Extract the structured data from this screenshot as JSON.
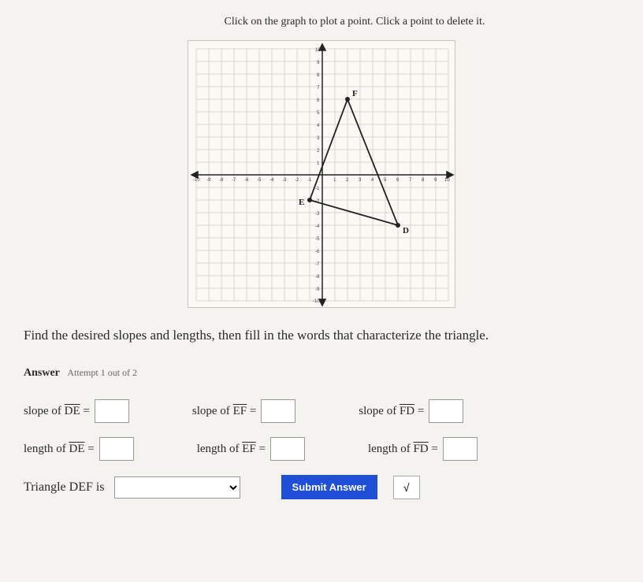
{
  "instruction": "Click on the graph to plot a point. Click a point to delete it.",
  "question": "Find the desired slopes and lengths, then fill in the words that characterize the triangle.",
  "answer": {
    "label": "Answer",
    "attempt": "Attempt 1 out of 2"
  },
  "fields": {
    "slopeDE": {
      "label_prefix": "slope of ",
      "seg": "DE",
      "equals": " ="
    },
    "slopeEF": {
      "label_prefix": "slope of ",
      "seg": "EF",
      "equals": " ="
    },
    "slopeFD": {
      "label_prefix": "slope of ",
      "seg": "FD",
      "equals": " ="
    },
    "lengthDE": {
      "label_prefix": "length of ",
      "seg": "DE",
      "equals": " ="
    },
    "lengthEF": {
      "label_prefix": "length of ",
      "seg": "EF",
      "equals": " ="
    },
    "lengthFD": {
      "label_prefix": "length of ",
      "seg": "FD",
      "equals": " ="
    }
  },
  "classify": {
    "label": "Triangle DEF is"
  },
  "submit_label": "Submit Answer",
  "sqrt_label": "√",
  "chart_data": {
    "type": "scatter",
    "title": "",
    "xlabel": "",
    "ylabel": "",
    "xlim": [
      -10,
      10
    ],
    "ylim": [
      -10,
      10
    ],
    "x_ticks": [
      -10,
      -9,
      -8,
      -7,
      -6,
      -5,
      -4,
      -3,
      -2,
      -1,
      1,
      2,
      3,
      4,
      5,
      6,
      7,
      8,
      9,
      10
    ],
    "y_ticks": [
      -10,
      -9,
      -8,
      -7,
      -6,
      -5,
      -4,
      -3,
      -2,
      -1,
      1,
      2,
      3,
      4,
      5,
      6,
      7,
      8,
      9,
      10
    ],
    "points": [
      {
        "name": "D",
        "x": 6,
        "y": -4
      },
      {
        "name": "E",
        "x": -1,
        "y": -2
      },
      {
        "name": "F",
        "x": 2,
        "y": 6
      }
    ],
    "segments": [
      {
        "from": "D",
        "to": "E"
      },
      {
        "from": "E",
        "to": "F"
      },
      {
        "from": "F",
        "to": "D"
      }
    ]
  }
}
